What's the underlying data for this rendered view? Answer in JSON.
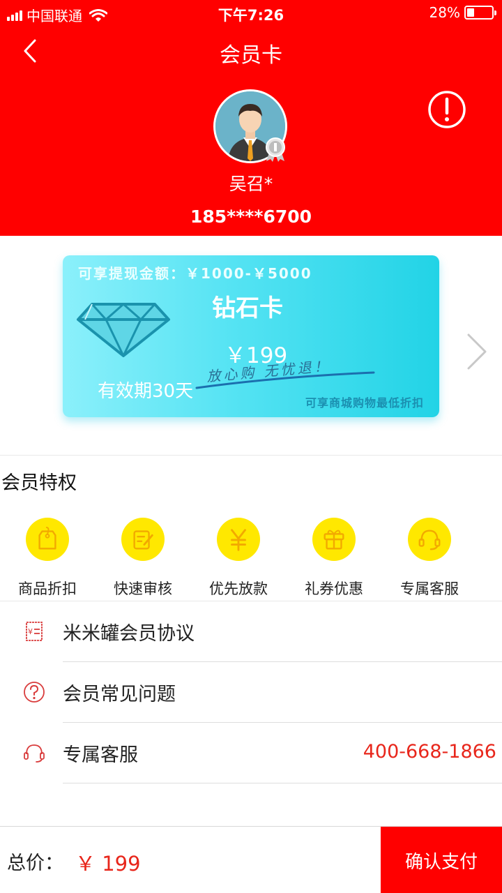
{
  "status_bar": {
    "carrier": "中国联通",
    "time": "下午7:26",
    "battery_percent": "28%",
    "battery_level": 0.28
  },
  "nav": {
    "back_icon": "chevron-left-icon",
    "title": "会员卡",
    "info_icon": "exclamation-circle-icon"
  },
  "user": {
    "name": "吴召*",
    "phone": "185****6700"
  },
  "card": {
    "range": "可享提现金额：￥1000-￥5000",
    "name": "钻石卡",
    "price": "￥199",
    "validity": "有效期30天",
    "slogan": "放心购 无忧退！",
    "note": "可享商城购物最低折扣"
  },
  "privileges": {
    "title": "会员特权",
    "items": [
      {
        "label": "商品折扣",
        "icon": "tag-icon"
      },
      {
        "label": "快速审核",
        "icon": "edit-icon"
      },
      {
        "label": "优先放款",
        "icon": "yen-icon"
      },
      {
        "label": "礼券优惠",
        "icon": "gift-icon"
      },
      {
        "label": "专属客服",
        "icon": "headset-icon"
      }
    ]
  },
  "menu": [
    {
      "label": "米米罐会员协议",
      "icon": "agreement-icon",
      "value": ""
    },
    {
      "label": "会员常见问题",
      "icon": "question-icon",
      "value": ""
    },
    {
      "label": "专属客服",
      "icon": "headset-icon",
      "value": "400-668-1866"
    }
  ],
  "footer": {
    "total_label": "总价：",
    "total_value": "￥ 199",
    "pay_label": "确认支付"
  },
  "colors": {
    "brand_red": "#ff0000",
    "accent_yellow": "#ffe800",
    "card_cyan": "#22d3e6",
    "price_red": "#e8261b"
  }
}
